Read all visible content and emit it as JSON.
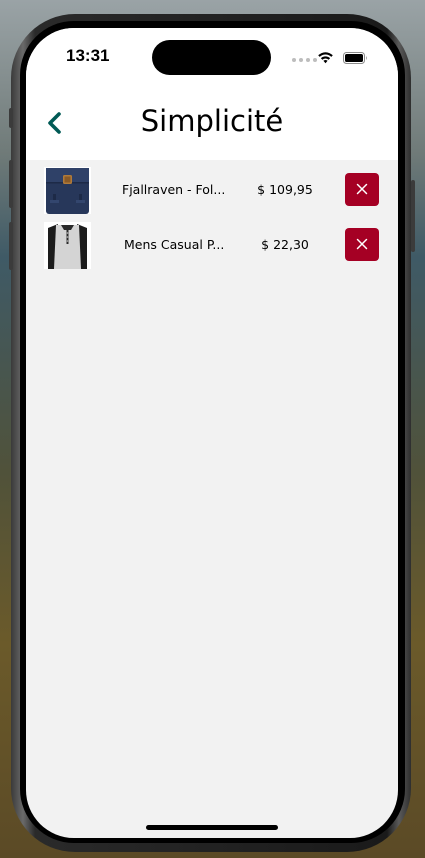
{
  "status_bar": {
    "time": "13:31",
    "wifi_icon": "wifi-icon",
    "battery_icon": "battery-icon"
  },
  "header": {
    "title": "Simplicité",
    "back_icon": "chevron-left-icon",
    "back_color": "#005a55"
  },
  "cart": {
    "items": [
      {
        "name": "Fjallraven - Fol...",
        "price": "$ 109,95",
        "thumbnail": "backpack-image",
        "remove_icon": "close-icon"
      },
      {
        "name": "Mens Casual P...",
        "price": "$ 22,30",
        "thumbnail": "shirt-image",
        "remove_icon": "close-icon"
      }
    ]
  },
  "colors": {
    "remove_button": "#a50024",
    "list_background": "#f2f2f2",
    "header_background": "#ffffff"
  }
}
